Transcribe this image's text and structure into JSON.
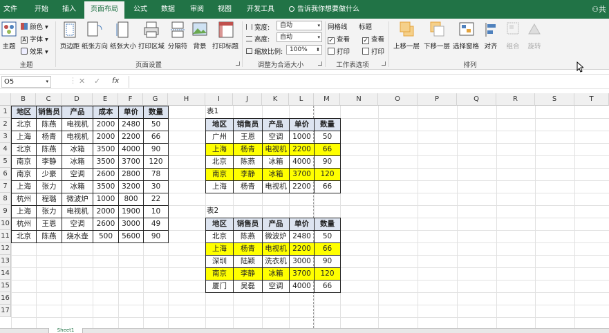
{
  "tabs": [
    {
      "label": "文件",
      "active": false
    },
    {
      "label": "开始",
      "active": false
    },
    {
      "label": "插入",
      "active": false
    },
    {
      "label": "页面布局",
      "active": true
    },
    {
      "label": "公式",
      "active": false
    },
    {
      "label": "数据",
      "active": false
    },
    {
      "label": "审阅",
      "active": false
    },
    {
      "label": "视图",
      "active": false
    },
    {
      "label": "开发工具",
      "active": false
    }
  ],
  "tell_me": "告诉我你想要做什么",
  "share": "共",
  "ribbon": {
    "themes": {
      "theme": "主题",
      "colors": "颜色",
      "fonts": "字体",
      "effects": "效果",
      "group": "主题"
    },
    "page_setup": {
      "margins": "页边距",
      "orientation": "纸张方向",
      "size": "纸张大小",
      "print_area": "打印区域",
      "breaks": "分隔符",
      "background": "背景",
      "print_titles": "打印标题",
      "group": "页面设置"
    },
    "scale": {
      "width_label": "宽度:",
      "width_value": "自动",
      "height_label": "高度:",
      "height_value": "自动",
      "scale_label": "缩放比例:",
      "scale_value": "100%",
      "group": "调整为合适大小"
    },
    "sheet_options": {
      "gridlines": "网格线",
      "headings": "标题",
      "view1": "查看",
      "print1": "打印",
      "view2": "查看",
      "print2": "打印",
      "group": "工作表选项"
    },
    "arrange": {
      "bring_forward": "上移一层",
      "send_backward": "下移一层",
      "selection_pane": "选择窗格",
      "align": "对齐",
      "group_btn": "组合",
      "rotate": "旋转",
      "group": "排列"
    }
  },
  "formula_bar": {
    "name_box": "O5",
    "fx": "fx",
    "cancel": "✕",
    "enter": "✓",
    "value": ""
  },
  "columns": [
    "B",
    "C",
    "D",
    "E",
    "F",
    "G",
    "H",
    "I",
    "J",
    "K",
    "L",
    "M",
    "N",
    "O",
    "P",
    "Q",
    "R",
    "S",
    "T"
  ],
  "rows": [
    "1",
    "2",
    "3",
    "4",
    "5",
    "6",
    "7",
    "8",
    "9",
    "10",
    "11",
    "12",
    "13",
    "14",
    "15",
    "16",
    "17"
  ],
  "main_table": {
    "headers": [
      "地区",
      "销售员",
      "产品",
      "成本",
      "单价",
      "数量"
    ],
    "rows": [
      [
        "北京",
        "陈燕",
        "电视机",
        "2000",
        "2480",
        "50"
      ],
      [
        "上海",
        "杨青",
        "电视机",
        "2000",
        "2200",
        "66"
      ],
      [
        "北京",
        "陈燕",
        "冰箱",
        "3500",
        "4000",
        "90"
      ],
      [
        "南京",
        "李静",
        "冰箱",
        "3500",
        "3700",
        "120"
      ],
      [
        "南京",
        "少豪",
        "空调",
        "2600",
        "2800",
        "78"
      ],
      [
        "上海",
        "张力",
        "冰箱",
        "3500",
        "3200",
        "30"
      ],
      [
        "杭州",
        "程璐",
        "微波炉",
        "1000",
        "800",
        "22"
      ],
      [
        "上海",
        "张力",
        "电视机",
        "2000",
        "1900",
        "10"
      ],
      [
        "杭州",
        "王恩",
        "空调",
        "2600",
        "3000",
        "49"
      ],
      [
        "北京",
        "陈燕",
        "烧水壶",
        "500",
        "5600",
        "90"
      ]
    ]
  },
  "table1": {
    "title": "表1",
    "headers": [
      "地区",
      "销售员",
      "产品",
      "单价",
      "数量"
    ],
    "rows": [
      [
        "广州",
        "王恩",
        "空调",
        "1000",
        "50"
      ],
      [
        "上海",
        "杨青",
        "电视机",
        "2200",
        "66"
      ],
      [
        "北京",
        "陈燕",
        "冰箱",
        "4000",
        "90"
      ],
      [
        "南京",
        "李静",
        "冰箱",
        "3700",
        "120"
      ],
      [
        "上海",
        "杨青",
        "电视机",
        "2200",
        "66"
      ]
    ],
    "highlighted": [
      false,
      true,
      false,
      true,
      false
    ]
  },
  "table2": {
    "title": "表2",
    "headers": [
      "地区",
      "销售员",
      "产品",
      "单价",
      "数量"
    ],
    "rows": [
      [
        "北京",
        "陈燕",
        "微波炉",
        "2480",
        "50"
      ],
      [
        "上海",
        "杨青",
        "电视机",
        "2200",
        "66"
      ],
      [
        "深圳",
        "陆颖",
        "洗衣机",
        "3000",
        "90"
      ],
      [
        "南京",
        "李静",
        "冰箱",
        "3700",
        "120"
      ],
      [
        "厦门",
        "吴磊",
        "空调",
        "4000",
        "66"
      ]
    ],
    "highlighted": [
      false,
      true,
      false,
      true,
      false
    ]
  },
  "colors": {
    "excel_green": "#217346",
    "highlight": "#ffff00",
    "header_fill": "#dde4f0"
  },
  "sheet_tab": "Sheet1"
}
